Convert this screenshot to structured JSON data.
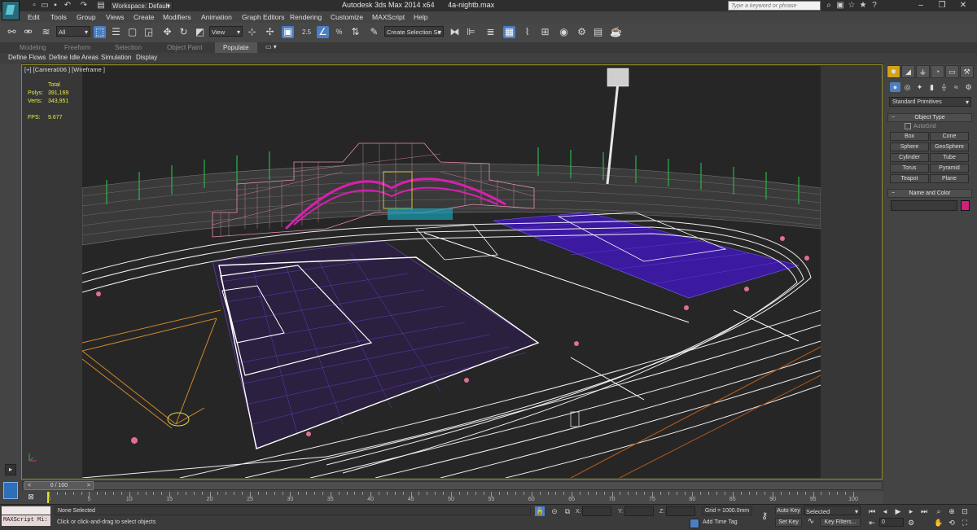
{
  "titlebar": {
    "workspace": "Workspace: Default",
    "app_title": "Autodesk 3ds Max  2014 x64",
    "file_name": "4a-nightb.max",
    "search_placeholder": "Type a keyword or phrase"
  },
  "menu": [
    "Edit",
    "Tools",
    "Group",
    "Views",
    "Create",
    "Modifiers",
    "Animation",
    "Graph Editors",
    "Rendering",
    "Customize",
    "MAXScript",
    "Help"
  ],
  "toolbar": {
    "selection_filter": "All",
    "reference_coord": "View",
    "named_selection_placeholder": "Create Selection Se",
    "snap_label": "2.5",
    "percent_snap_label": "%"
  },
  "ribbon": {
    "tabs": [
      "Modeling",
      "Freeform",
      "Selection",
      "Object Paint",
      "Populate"
    ],
    "active_tab": "Populate",
    "subtabs": [
      "Define Flows",
      "Define Idle Areas",
      "Simulation",
      "Display"
    ]
  },
  "viewport": {
    "label": "[+] [Camera006 ] [Wireframe ]",
    "stats": {
      "total_label": "Total",
      "polys_label": "Polys:",
      "polys_value": "391,169",
      "verts_label": "Verts:",
      "verts_value": "343,951",
      "fps_label": "FPS:",
      "fps_value": "9.677"
    }
  },
  "command_panel": {
    "category": "Standard Primitives",
    "object_type_title": "Object Type",
    "autogrid": "AutoGrid",
    "object_buttons": [
      "Box",
      "Cone",
      "Sphere",
      "GeoSphere",
      "Cylinder",
      "Tube",
      "Torus",
      "Pyramid",
      "Teapot",
      "Plane"
    ],
    "name_color_title": "Name and Color",
    "swatch_color": "#d21e7d"
  },
  "timeline": {
    "slider_label": "0 / 100",
    "ticks": [
      "0",
      "5",
      "10",
      "15",
      "20",
      "25",
      "30",
      "35",
      "40",
      "45",
      "50",
      "55",
      "60",
      "65",
      "70",
      "75",
      "80",
      "85",
      "90",
      "95",
      "100"
    ]
  },
  "status": {
    "maxscript_label": "MAXScript Mi:",
    "selection_status": "None Selected",
    "prompt": "Click or click-and-drag to select objects",
    "x_label": "X:",
    "y_label": "Y:",
    "z_label": "Z:",
    "grid": "Grid = 1000.0mm",
    "add_time_tag": "Add Time Tag",
    "auto_key": "Auto Key",
    "auto_key_mode": "Selected",
    "set_key": "Set Key",
    "key_filters": "Key Filters...",
    "frame_value": "0"
  }
}
